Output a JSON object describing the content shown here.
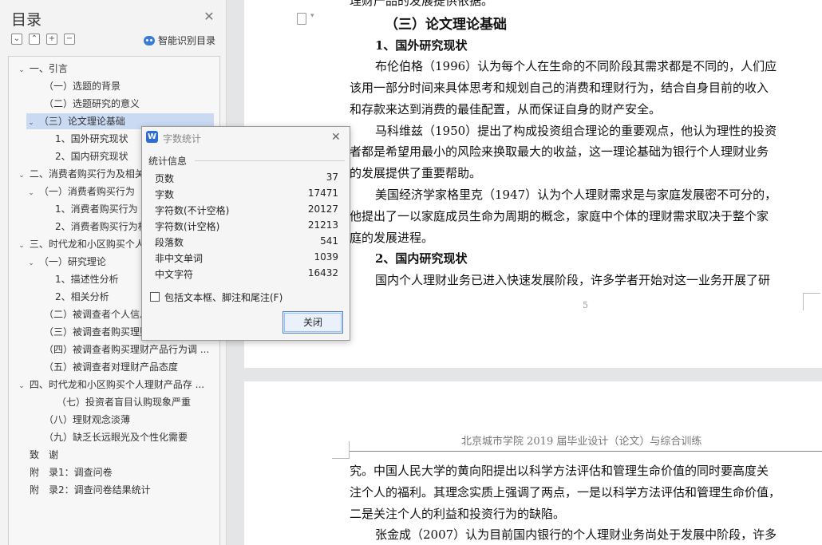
{
  "sidebar": {
    "title": "目录",
    "smart_label": "智能识别目录",
    "items": [
      {
        "label": "一、引言",
        "expanded": true
      },
      {
        "label": "（一）选题的背景"
      },
      {
        "label": "（二）选题研究的意义"
      },
      {
        "label": "（三）论文理论基础",
        "expanded": true,
        "selected": true
      },
      {
        "label": "1、国外研究现状"
      },
      {
        "label": "2、国内研究现状"
      },
      {
        "label": "二、消费者购买行为及相关"
      },
      {
        "label": "（一）消费者购买行为",
        "expanded": true
      },
      {
        "label": "1、消费者购买行为"
      },
      {
        "label": "2、消费者购买行为相"
      },
      {
        "label": "三、时代龙和小区购买个人"
      },
      {
        "label": "（一）研究理论",
        "expanded": true
      },
      {
        "label": "1、描述性分析"
      },
      {
        "label": "2、相关分析"
      },
      {
        "label": "（二）被调查者个人信息"
      },
      {
        "label": "（三）被调查者购买理财"
      },
      {
        "label": "（四）被调查者购买理财产品行为调 ..."
      },
      {
        "label": "（五）被调查者对理财产品态度"
      },
      {
        "label": "四、时代龙和小区购买个人理财产品存 ...",
        "expanded": true
      },
      {
        "label": "（七）投资者盲目认购现象严重"
      },
      {
        "label": "（八）理财观念淡薄"
      },
      {
        "label": "（九）缺乏长远眼光及个性化需要"
      },
      {
        "label": "致　谢"
      },
      {
        "label": "附　录1：调查问卷"
      },
      {
        "label": "附　录2：调查问卷结果统计"
      }
    ]
  },
  "document": {
    "page1": {
      "top_cut": "理财产品的发展提供依据。",
      "heading": "（三）论文理论基础",
      "sub1": "1、国外研究现状",
      "p1": [
        "布伦伯格（1996）认为每个人在生命的不同阶段其需求都是不同的，人们应",
        "该用一部分时间来具体思考和规划自己的消费和理财行为，结合自身目前的收入",
        "和存款来达到消费的最佳配置，从而保证自身的财产安全。"
      ],
      "p2": [
        "马科维兹（1950）提出了构成投资组合理论的重要观点，他认为理性的投资",
        "者都是希望用最小的风险来换取最大的收益，这一理论基础为银行个人理财业务",
        "的发展提供了重要帮助。"
      ],
      "p3": [
        "美国经济学家格里克（1947）认为个人理财需求是与家庭发展密不可分的，",
        "他提出了一以家庭成员生命为周期的概念，家庭中个体的理财需求取决于整个家",
        "庭的发展进程。"
      ],
      "sub2": "2、国内研究现状",
      "p4": "国内个人理财业务已进入快速发展阶段，许多学者开始对这一业务开展了研",
      "page_number": "5"
    },
    "page2": {
      "header": "北京城市学院 2019 届毕业设计（论文）与综合训练",
      "lines": [
        "究。中国人民大学的黄向阳提出以科学方法评估和管理生命价值的同时要高度关",
        "注个人的福利。其理念实质上强调了两点，一是以科学方法评估和管理生命价值，",
        "二是关注个人的利益和投资行为的缺陷。",
        "张金成（2007）认为目前国内银行的个人理财业务尚处于发展中阶段，许多"
      ]
    }
  },
  "dialog": {
    "title": "字数统计",
    "section": "统计信息",
    "stats": [
      {
        "label": "页数",
        "value": "37"
      },
      {
        "label": "字数",
        "value": "17471"
      },
      {
        "label": "字符数(不计空格)",
        "value": "20127"
      },
      {
        "label": "字符数(计空格)",
        "value": "21213"
      },
      {
        "label": "段落数",
        "value": "541"
      },
      {
        "label": "非中文单词",
        "value": "1039"
      },
      {
        "label": "中文字符",
        "value": "16432"
      }
    ],
    "checkbox_label": "包括文本框、脚注和尾注(F)",
    "close_label": "关闭"
  }
}
